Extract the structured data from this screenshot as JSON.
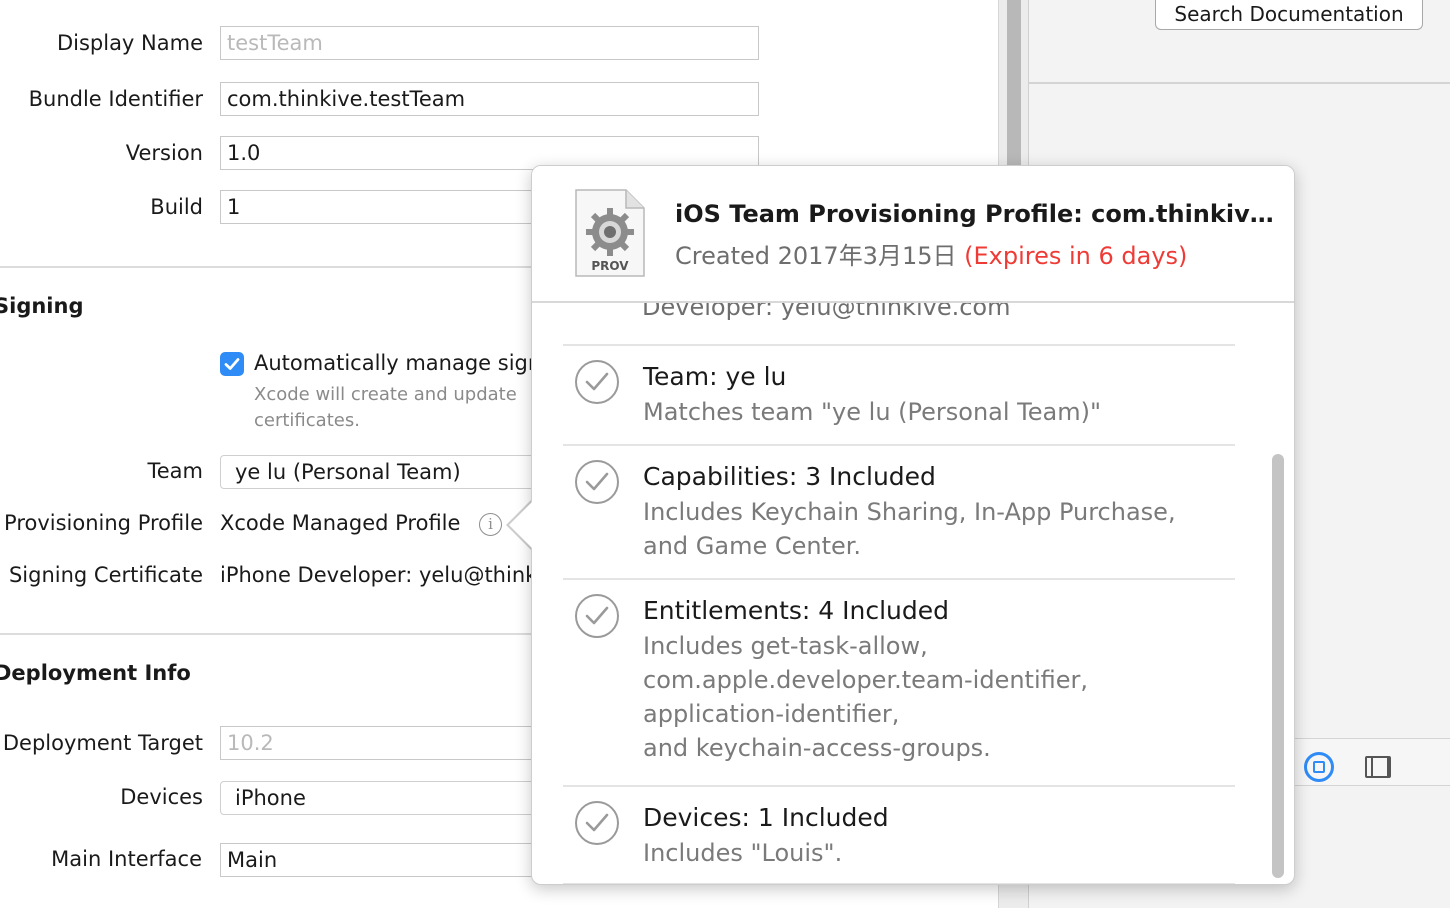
{
  "identity": {
    "display_name_label": "Display Name",
    "display_name_value": "testTeam",
    "bundle_id_label": "Bundle Identifier",
    "bundle_id_value": "com.thinkive.testTeam",
    "version_label": "Version",
    "version_value": "1.0",
    "build_label": "Build",
    "build_value": "1"
  },
  "signing": {
    "section_title": "Signing",
    "auto_manage_label": "Automatically manage sign",
    "auto_manage_checked": true,
    "auto_manage_help_1": "Xcode will create and update",
    "auto_manage_help_2": "certificates.",
    "team_label": "Team",
    "team_value": "ye lu (Personal Team)",
    "profile_label": "Provisioning Profile",
    "profile_value": "Xcode Managed Profile",
    "certificate_label": "Signing Certificate",
    "certificate_value": "iPhone Developer: yelu@think"
  },
  "deployment": {
    "section_title": "Deployment Info",
    "target_label": "Deployment Target",
    "target_value": "10.2",
    "devices_label": "Devices",
    "devices_value": "iPhone",
    "main_interface_label": "Main Interface",
    "main_interface_value": "Main"
  },
  "right_panel": {
    "search_doc_label": "Search Documentation"
  },
  "popover": {
    "icon_label": "PROV",
    "title": "iOS Team Provisioning Profile: com.thinkive.t...",
    "created": "Created 2017年3月15日 ",
    "expires": "(Expires in 6 days)",
    "cut_line": "Developer: yelu@thinkive.com",
    "rows": [
      {
        "title": "Team: ye lu",
        "desc": [
          "Matches team \"ye lu (Personal Team)\""
        ]
      },
      {
        "title": "Capabilities: 3 Included",
        "desc": [
          "Includes Keychain Sharing, In-App Purchase,",
          "and Game Center."
        ]
      },
      {
        "title": "Entitlements: 4 Included",
        "desc": [
          "Includes get-task-allow,",
          "com.apple.developer.team-identifier,",
          "application-identifier,",
          "and keychain-access-groups."
        ]
      },
      {
        "title": "Devices: 1 Included",
        "desc": [
          "Includes \"Louis\"."
        ]
      }
    ]
  },
  "colors": {
    "accent": "#2f8bf5",
    "warning": "#ef3b36"
  },
  "icons": [
    "checkbox-checked-icon",
    "info-icon",
    "prov-file-icon",
    "checkmark-circle-icon",
    "object-library-icon",
    "media-library-icon"
  ]
}
